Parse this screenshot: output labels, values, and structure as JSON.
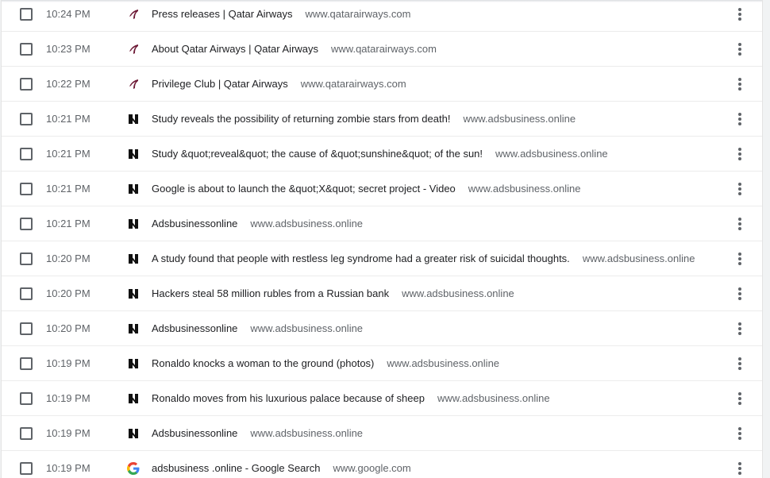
{
  "history": {
    "entries": [
      {
        "time": "10:24 PM",
        "icon": "qatar-airways-icon",
        "title": "Press releases | Qatar Airways",
        "domain": "www.qatarairways.com"
      },
      {
        "time": "10:23 PM",
        "icon": "qatar-airways-icon",
        "title": "About Qatar Airways | Qatar Airways",
        "domain": "www.qatarairways.com"
      },
      {
        "time": "10:22 PM",
        "icon": "qatar-airways-icon",
        "title": "Privilege Club | Qatar Airways",
        "domain": "www.qatarairways.com"
      },
      {
        "time": "10:21 PM",
        "icon": "adsbusiness-icon",
        "title": "Study reveals the possibility of returning zombie stars from death!",
        "domain": "www.adsbusiness.online"
      },
      {
        "time": "10:21 PM",
        "icon": "adsbusiness-icon",
        "title": "Study &quot;reveal&quot; the cause of &quot;sunshine&quot; of the sun!",
        "domain": "www.adsbusiness.online"
      },
      {
        "time": "10:21 PM",
        "icon": "adsbusiness-icon",
        "title": "Google is about to launch the &quot;X&quot; secret project - Video",
        "domain": "www.adsbusiness.online"
      },
      {
        "time": "10:21 PM",
        "icon": "adsbusiness-icon",
        "title": "Adsbusinessonline",
        "domain": "www.adsbusiness.online"
      },
      {
        "time": "10:20 PM",
        "icon": "adsbusiness-icon",
        "title": "A study found that people with restless leg syndrome had a greater risk of suicidal thoughts.",
        "domain": "www.adsbusiness.online"
      },
      {
        "time": "10:20 PM",
        "icon": "adsbusiness-icon",
        "title": "Hackers steal 58 million rubles from a Russian bank",
        "domain": "www.adsbusiness.online"
      },
      {
        "time": "10:20 PM",
        "icon": "adsbusiness-icon",
        "title": "Adsbusinessonline",
        "domain": "www.adsbusiness.online"
      },
      {
        "time": "10:19 PM",
        "icon": "adsbusiness-icon",
        "title": "Ronaldo knocks a woman to the ground (photos)",
        "domain": "www.adsbusiness.online"
      },
      {
        "time": "10:19 PM",
        "icon": "adsbusiness-icon",
        "title": "Ronaldo moves from his luxurious palace because of sheep",
        "domain": "www.adsbusiness.online"
      },
      {
        "time": "10:19 PM",
        "icon": "adsbusiness-icon",
        "title": "Adsbusinessonline",
        "domain": "www.adsbusiness.online"
      },
      {
        "time": "10:19 PM",
        "icon": "google-icon",
        "title": "adsbusiness .online - Google Search",
        "domain": "www.google.com"
      }
    ]
  }
}
